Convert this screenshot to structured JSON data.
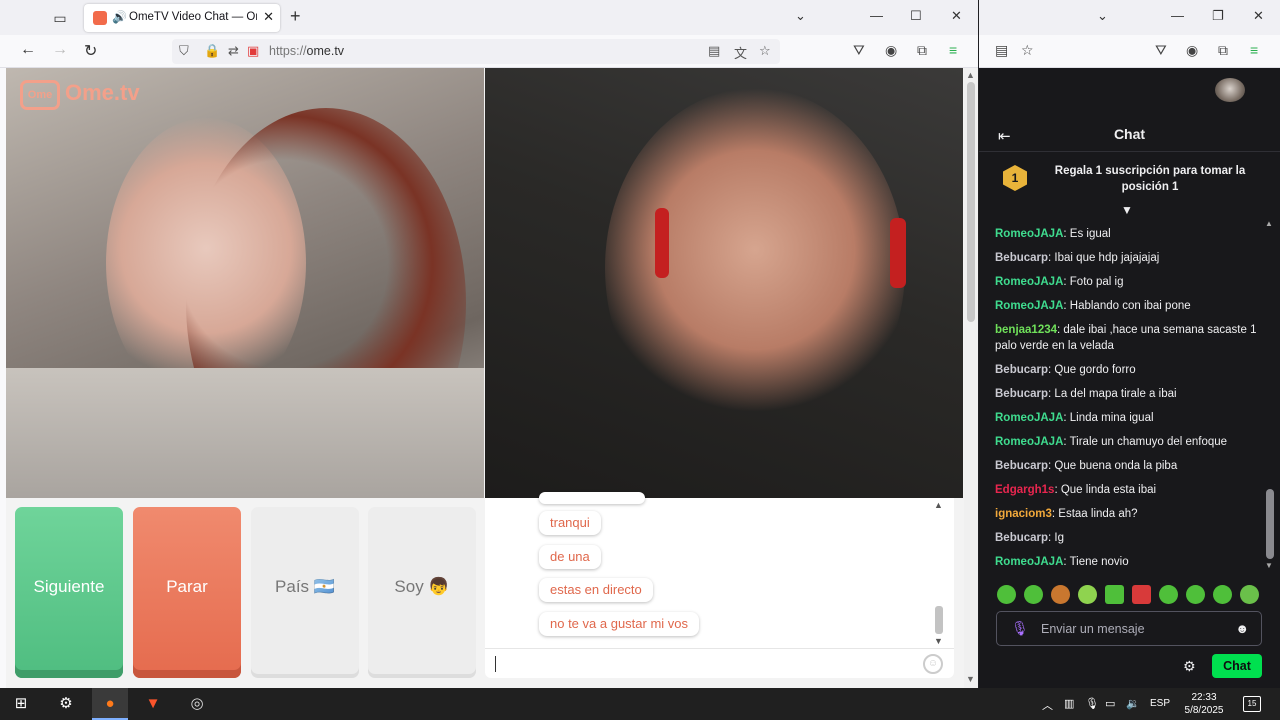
{
  "browser": {
    "tab_title": "OmeTV Video Chat — Ome",
    "url_dim": "https://",
    "url_host": "ome.tv"
  },
  "ometv": {
    "logo_box": "Ome",
    "logo_text": "Ome.tv",
    "buttons": {
      "next": "Siguiente",
      "stop": "Parar",
      "country": "País 🇦🇷",
      "me": "Soy 👦"
    },
    "messages": [
      "tranqui",
      "de una",
      "estas en directo",
      "no te va a gustar mi vos"
    ]
  },
  "stream_chat": {
    "title": "Chat",
    "gift_rank": "1",
    "gift_text": "Regala 1 suscripción para tomar la posición 1",
    "messages": [
      {
        "user": "RomeoJAJA",
        "text": ": Es igual",
        "color": "#3fdc8f"
      },
      {
        "user": "Bebucarp",
        "text": ": Ibai que hdp jajajajaj",
        "color": "#c9c9d1"
      },
      {
        "user": "RomeoJAJA",
        "text": ": Foto pal ig",
        "color": "#3fdc8f"
      },
      {
        "user": "RomeoJAJA",
        "text": ": Hablando con ibai pone",
        "color": "#3fdc8f"
      },
      {
        "user": "benjaa1234",
        "text": ": dale ibai ,hace una semana sacaste 1 palo verde en la velada",
        "color": "#6fe05a"
      },
      {
        "user": "Bebucarp",
        "text": ": Que gordo forro",
        "color": "#c9c9d1"
      },
      {
        "user": "Bebucarp",
        "text": ": La del mapa tirale a ibai",
        "color": "#c9c9d1"
      },
      {
        "user": "RomeoJAJA",
        "text": ": Linda mina igual",
        "color": "#3fdc8f"
      },
      {
        "user": "RomeoJAJA",
        "text": ": Tirale un chamuyo del enfoque",
        "color": "#3fdc8f"
      },
      {
        "user": "Bebucarp",
        "text": ": Que buena onda la piba",
        "color": "#c9c9d1"
      },
      {
        "user": "Edgargh1s",
        "text": ": Que linda esta ibai",
        "color": "#e8264f"
      },
      {
        "user": "ignaciom3",
        "text": ": Estaa linda ah?",
        "color": "#f2a93b"
      },
      {
        "user": "Bebucarp",
        "text": ": Ig",
        "color": "#c9c9d1"
      },
      {
        "user": "RomeoJAJA",
        "text": ": Tiene novio",
        "color": "#3fdc8f"
      }
    ],
    "input_placeholder": "Enviar un mensaje",
    "send_label": "Chat"
  },
  "taskbar": {
    "lang": "ESP",
    "time": "22:33",
    "date": "5/8/2025",
    "notifications": "15"
  },
  "colors": {
    "accent_green": "#00e04f",
    "ome_orange": "#e56b4e",
    "ome_green": "#4fbd80"
  }
}
